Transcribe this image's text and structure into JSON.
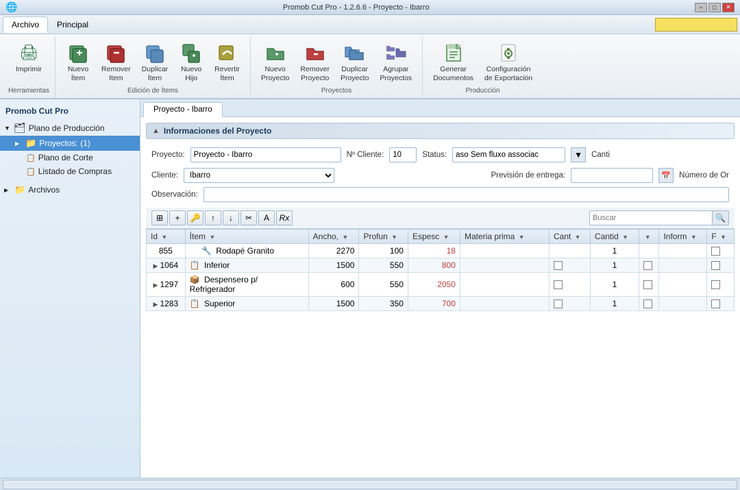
{
  "titleBar": {
    "appIcon": "🌐",
    "title": "Promob Cut Pro - 1.2.6.6 - Proyecto - Ibarro",
    "minimize": "−",
    "maximize": "□",
    "close": "✕"
  },
  "menuBar": {
    "tabs": [
      {
        "label": "Archivo",
        "active": true
      },
      {
        "label": "Principal",
        "active": false
      }
    ],
    "input": ""
  },
  "ribbon": {
    "groups": [
      {
        "label": "Herramientas",
        "items": [
          {
            "id": "imprimir",
            "icon": "🖨",
            "label": "Imprimir",
            "lines": [
              "Imprimir"
            ]
          }
        ]
      },
      {
        "label": "Edición de Ítems",
        "items": [
          {
            "id": "nuevo-item",
            "icon": "📦",
            "label": "Nuevo\nÍtem"
          },
          {
            "id": "remover-item",
            "icon": "📦",
            "label": "Remover\nItem"
          },
          {
            "id": "duplicar-item",
            "icon": "📋",
            "label": "Duplicar\nÍtem"
          },
          {
            "id": "nuevo-hijo",
            "icon": "📦",
            "label": "Nuevo\nHijo"
          },
          {
            "id": "revertir-item",
            "icon": "↩",
            "label": "Revertir\nÍtem"
          }
        ]
      },
      {
        "label": "Proyectos",
        "items": [
          {
            "id": "nuevo-proyecto",
            "icon": "🗂",
            "label": "Nuevo\nProyecto"
          },
          {
            "id": "remover-proyecto",
            "icon": "🗂",
            "label": "Remover\nProyecto"
          },
          {
            "id": "duplicar-proyecto",
            "icon": "🗂",
            "label": "Duplicar\nProyecto"
          },
          {
            "id": "agrupar-proyectos",
            "icon": "🗂",
            "label": "Agrupar\nProyectos"
          }
        ]
      },
      {
        "label": "Producción",
        "items": [
          {
            "id": "generar-doc",
            "icon": "📄",
            "label": "Generar\nDocumentos"
          },
          {
            "id": "config-export",
            "icon": "⚙",
            "label": "Configuración\nde Exportación"
          }
        ]
      }
    ]
  },
  "sidebar": {
    "title": "Promob Cut Pro",
    "tree": [
      {
        "label": "Plano de Producción",
        "level": 0,
        "expand": true,
        "icon": "▼",
        "type": "folder"
      },
      {
        "label": "Proyectos: (1)",
        "level": 1,
        "expand": false,
        "icon": "📁",
        "type": "project",
        "selected": true
      },
      {
        "label": "Plano de Corte",
        "level": 2,
        "icon": "📋",
        "type": "leaf"
      },
      {
        "label": "Listado de Compras",
        "level": 2,
        "icon": "📋",
        "type": "leaf"
      },
      {
        "label": "Archivos",
        "level": 0,
        "expand": false,
        "icon": "📁",
        "type": "folder"
      }
    ]
  },
  "contentTab": "Proyecto - Ibarro",
  "projectInfo": {
    "sectionTitle": "Informaciones del Proyecto",
    "labels": {
      "proyecto": "Proyecto:",
      "cliente": "Cliente:",
      "observacion": "Observación:",
      "nroCliente": "Nº Cliente:",
      "status": "Status:",
      "prevision": "Previsión de entrega:",
      "nroOrden": "Número de Or",
      "canti": "Canti"
    },
    "values": {
      "proyecto": "Proyecto - Ibarro",
      "cliente": "Ibarro",
      "observacion": "",
      "nroCliente": "10",
      "status": "aso Sem fluxo associac",
      "prevision": "",
      "nroOrden": ""
    }
  },
  "tableToolbar": {
    "buttons": [
      "🗄",
      "+",
      "🔑",
      "↑",
      "↓",
      "✂",
      "A",
      "Rx"
    ],
    "searchPlaceholder": "Buscar"
  },
  "table": {
    "columns": [
      "Id",
      "Ítem",
      "Ancho,",
      "Profun",
      "Espesc",
      "Materia prima",
      "Cant",
      "Cantid",
      "",
      "Inform",
      "F"
    ],
    "rows": [
      {
        "id": "855",
        "expand": false,
        "icon": "🔧",
        "item": "Rodapé Granito",
        "ancho": "2270",
        "profun": "100",
        "espesc": "18",
        "materia": "",
        "cant": "",
        "cantid": "1",
        "check2": false,
        "inform": "",
        "f": false
      },
      {
        "id": "1064",
        "expand": true,
        "icon": "📋",
        "item": "Inferior",
        "ancho": "1500",
        "profun": "550",
        "espesc": "800",
        "materia": "",
        "cant": false,
        "cantid": "1",
        "check2": false,
        "inform": "",
        "f": false
      },
      {
        "id": "1297",
        "expand": true,
        "icon": "📦",
        "item": "Despensero p/ Refrigerador",
        "ancho": "600",
        "profun": "550",
        "espesc": "2050",
        "materia": "",
        "cant": false,
        "cantid": "1",
        "check2": false,
        "inform": "",
        "f": false
      },
      {
        "id": "1283",
        "expand": true,
        "icon": "📋",
        "item": "Superior",
        "ancho": "1500",
        "profun": "350",
        "espesc": "700",
        "materia": "",
        "cant": false,
        "cantid": "1",
        "check2": false,
        "inform": "",
        "f": false
      }
    ]
  }
}
